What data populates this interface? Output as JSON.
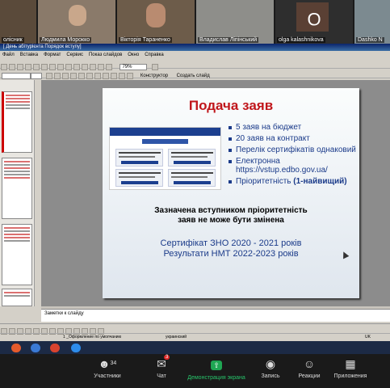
{
  "participants": [
    {
      "name": "олісник",
      "initial": ""
    },
    {
      "name": "Людмила Морокко",
      "initial": ""
    },
    {
      "name": "Вікторія Тараненко",
      "initial": ""
    },
    {
      "name": "Владислав Ліпінський",
      "initial": ""
    },
    {
      "name": "olga kalashnikova",
      "initial": "O"
    },
    {
      "name": "Dashko N",
      "initial": ""
    }
  ],
  "ppt": {
    "window_title": "[ День абітурієнта Порядок вступу]",
    "menu": [
      "Файл",
      "Вставка",
      "Формат",
      "Сервис",
      "Показ слайдов",
      "Окно",
      "Справка"
    ],
    "zoom": "79%",
    "designer_label": "Конструктор",
    "create_slide_label": "Создать слайд",
    "notes_placeholder": "Заметки к слайду",
    "status_left": "1 _Оформление по умолчанию",
    "status_mid": "украинский",
    "status_right": "UK"
  },
  "slide": {
    "title": "Подача заяв",
    "bullets": [
      "5 заяв на бюджет",
      "20 заяв на контракт",
      "Перелік сертифікатів однаковий",
      "Електронна https://vstup.edbo.gov.ua/",
      "Пріоритетність (1-найвищий)"
    ],
    "note_line1": "Зазначена вступником пріоритетність",
    "note_line2": "заяв не може бути змінена",
    "cert_line1": "Сертифікат ЗНО 2020 - 2021 років",
    "cert_line2": "Результати НМТ 2022-2023 років"
  },
  "zoom_toolbar": {
    "participants_label": "Участники",
    "participants_count": "34",
    "chat_label": "Чат",
    "chat_badge": "3",
    "share_label": "Демонстрация экрана",
    "record_label": "Запись",
    "reactions_label": "Реакции",
    "apps_label": "Приложения"
  },
  "colors": {
    "title_red": "#c0161b",
    "bullet_blue": "#1b3b8a",
    "share_green": "#1fa653"
  }
}
